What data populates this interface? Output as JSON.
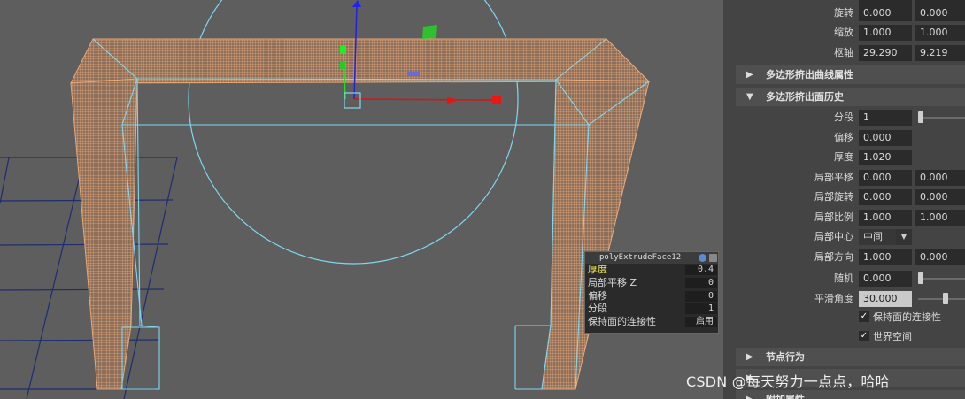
{
  "viewport": {
    "name": "3d-viewport"
  },
  "extrude_popup": {
    "title": "polyExtrudeFace12",
    "rows": [
      {
        "label": "厚度",
        "value": "0.4"
      },
      {
        "label": "局部平移 Z",
        "value": "0"
      },
      {
        "label": "偏移",
        "value": "0"
      },
      {
        "label": "分段",
        "value": "1"
      },
      {
        "label": "保持面的连接性",
        "value": "启用"
      }
    ]
  },
  "attributes": {
    "rotate": {
      "label": "旋转",
      "x": "0.000",
      "y": "0.000"
    },
    "scale": {
      "label": "缩放",
      "x": "1.000",
      "y": "1.000"
    },
    "pivot": {
      "label": "枢轴",
      "x": "29.290",
      "y": "9.219"
    },
    "section_curve": "多边形挤出曲线属性",
    "section_history": "多边形挤出面历史",
    "divisions": {
      "label": "分段",
      "value": "1"
    },
    "offset": {
      "label": "偏移",
      "value": "0.000"
    },
    "thickness": {
      "label": "厚度",
      "value": "1.020"
    },
    "local_translate": {
      "label": "局部平移",
      "x": "0.000",
      "y": "0.000"
    },
    "local_rotate": {
      "label": "局部旋转",
      "x": "0.000",
      "y": "0.000"
    },
    "local_scale": {
      "label": "局部比例",
      "x": "1.000",
      "y": "1.000"
    },
    "local_center": {
      "label": "局部中心",
      "value": "中间"
    },
    "local_direction": {
      "label": "局部方向",
      "x": "1.000",
      "y": "0.000"
    },
    "random": {
      "label": "随机",
      "value": "0.000"
    },
    "smoothing_angle": {
      "label": "平滑角度",
      "value": "30.000"
    },
    "keep_faces_together": {
      "label": "保持面的连接性",
      "checked": true
    },
    "world_space": {
      "label": "世界空间",
      "checked": true
    },
    "section_node": "节点行为",
    "section_extra": "附加属性"
  },
  "watermark": "CSDN @每天努力一点点，哈哈",
  "colors": {
    "viewport_bg": "#5e5e5e",
    "panel_bg": "#444444",
    "field_bg": "#2b2b2b",
    "wire_selected": "#e8a978",
    "wire_cyan": "#7fd8f0",
    "grid_navy": "#1a2a6a",
    "popup_highlight": "#f0e84a"
  }
}
